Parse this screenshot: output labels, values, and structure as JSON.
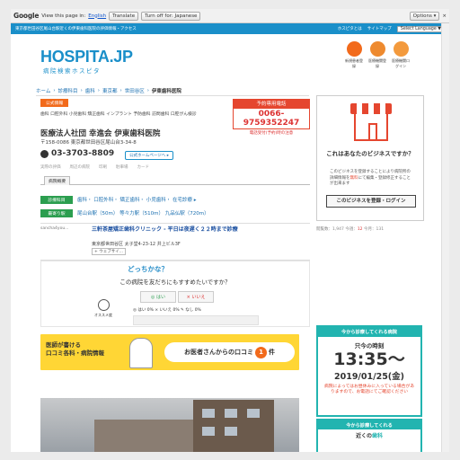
{
  "translate_bar": {
    "logo": "Google",
    "prompt": "View this page in:",
    "language": "English",
    "translate_label": "Translate",
    "turn_off_label": "Turn off for: Japanese",
    "options_label": "Options ▾",
    "close": "×"
  },
  "topbar": {
    "text": "東京都世田谷区尾山台駅近くの伊東歯科医院の評価情報・アクセス",
    "link1": "ホスピタとは",
    "link2": "サイトマップ",
    "lang_select": "Select Language ▼"
  },
  "header": {
    "logo": "HOSPITA.JP",
    "logo_sub": "病院検索ホスピタ",
    "icons": [
      {
        "label": "新規患者登録",
        "name": "new-patient-register-icon"
      },
      {
        "label": "医療機関登録",
        "name": "medical-register-icon"
      },
      {
        "label": "医療機関ログイン",
        "name": "medical-login-icon"
      }
    ]
  },
  "breadcrumb": [
    "ホーム",
    "診療科目",
    "歯科",
    "東京都",
    "世田谷区"
  ],
  "breadcrumb_current": "伊東歯科医院",
  "hospital": {
    "official_tag": "公式情報",
    "categories": "歯科 口腔外科 小児歯科 矯正歯科 インプラント 予防歯科 訪問歯科 口腔がん検診",
    "name": "医療法人社団 幸進会 伊東歯科医院",
    "address": "〒158-0086 東京都世田谷区尾山台3-34-8",
    "tel": "03-3703-8809",
    "homepage_btn": "公式ホームページへ ▸",
    "icon_labels": [
      "実際の評価",
      "周辺の病院",
      "印刷",
      "駐車場",
      "カード"
    ],
    "tab_overview": "病院概要",
    "reservation_label": "予約専用電話",
    "reservation_phone": "0066-9759352247",
    "reservation_note": "電話受付(予約)時の注意"
  },
  "info_rows": [
    {
      "label": "診療科目",
      "value": "歯科・ 口腔外科・ 矯正歯科・ 小児歯科・ 在宅診療 ▸"
    },
    {
      "label": "最寄り駅",
      "value": "尾山台駅（50m） 等々力駅（510m） 九品仏駅（720m）"
    }
  ],
  "ad": {
    "source": "sancha4you...",
    "title": "三軒茶屋矯正歯科クリニック - 平日は夜遅く２２時まで診療",
    "address": "東京都世田谷区 太子堂4-23-12 井上ビル3F",
    "more": "+ ウェブサイ..."
  },
  "recommend": {
    "title": "どっちかな？",
    "question": "この病院を友だちにもすすめたいですか？",
    "yes": "◎ はい",
    "no": "× いいえ",
    "icon_label": "オススメ度",
    "stats": "◎ はい 0%  × いいえ 0%  ✎ なし 0%"
  },
  "banner": {
    "left_line1": "医師が書ける",
    "left_line2": "口コミ各科・病院情報",
    "right_text": "お医者さんからの口コミ",
    "count": "1",
    "suffix": "件"
  },
  "sidebar": {
    "title": "これはあなたのビジネスですか？",
    "desc_pre": "このビジネスを登録することにより病院所の詳細情報を",
    "desc_em": "無料",
    "desc_post": "にて編集・登録修正することが出来ます",
    "button": "このビジネスを登録・ログイン",
    "stats_pre": "閲覧数：1,947  今週：",
    "stats_num": "12",
    "stats_post": "  今月：131"
  },
  "now_box": {
    "header": "今から診療してくれる病院",
    "label": "只今の時刻",
    "time": "13:35〜",
    "date": "2019/01/25(金)",
    "note": "病院によってはお昼休みに入っている場合がありますので、お電話にてご確認ください"
  },
  "now_box2": {
    "header": "今から診療してくれる",
    "sub_pre": "近くの",
    "sub_em": "歯科"
  },
  "colors": {
    "brand": "#1a8fc9",
    "accent": "#f26a1b",
    "green": "#2b9e4f",
    "teal": "#22b4b0",
    "red": "#e5462f",
    "banner": "#ffd635"
  }
}
